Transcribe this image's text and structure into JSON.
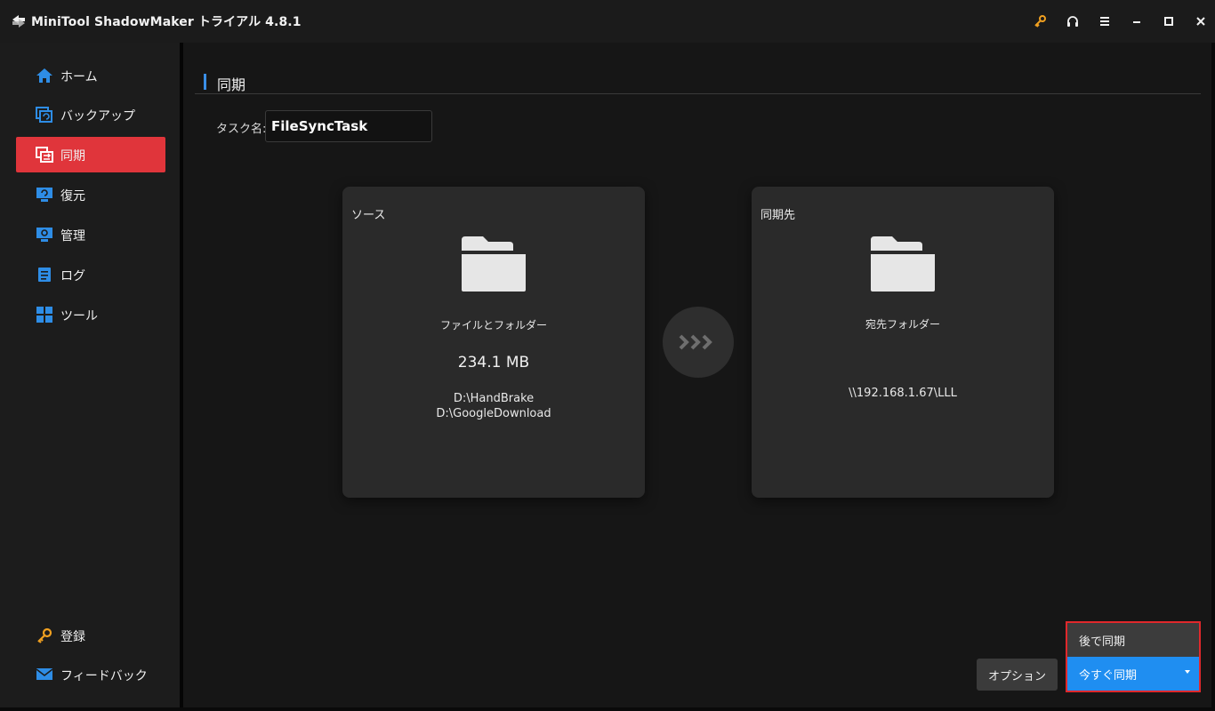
{
  "window": {
    "title": "MiniTool ShadowMaker トライアル 4.8.1",
    "buttons": [
      "key-icon",
      "headset-icon",
      "menu-icon",
      "minimize-icon",
      "maximize-icon",
      "close-icon"
    ]
  },
  "sidebar": {
    "items": [
      {
        "label": "ホーム",
        "icon": "home-icon",
        "active": false
      },
      {
        "label": "バックアップ",
        "icon": "backup-icon",
        "active": false
      },
      {
        "label": "同期",
        "icon": "sync-icon",
        "active": true
      },
      {
        "label": "復元",
        "icon": "restore-icon",
        "active": false
      },
      {
        "label": "管理",
        "icon": "manage-icon",
        "active": false
      },
      {
        "label": "ログ",
        "icon": "log-icon",
        "active": false
      },
      {
        "label": "ツール",
        "icon": "tools-icon",
        "active": false
      }
    ],
    "bottom_items": [
      {
        "label": "登録",
        "icon": "key-icon"
      },
      {
        "label": "フィードバック",
        "icon": "mail-icon"
      }
    ]
  },
  "main": {
    "section_title": "同期",
    "task_label": "タスク名:",
    "task_name": "FileSyncTask",
    "source": {
      "title": "ソース",
      "subtitle": "ファイルとフォルダー",
      "size": "234.1 MB",
      "paths": [
        "D:\\HandBrake",
        "D:\\GoogleDownload"
      ]
    },
    "destination": {
      "title": "同期先",
      "subtitle": "宛先フォルダー",
      "path": "\\\\192.168.1.67\\LLL"
    },
    "buttons": {
      "options": "オプション",
      "sync_later": "後で同期",
      "sync_now": "今すぐ同期"
    }
  },
  "colors": {
    "accent_red": "#e0353b",
    "accent_blue": "#1f8ef1",
    "highlight_border": "#e0282b"
  }
}
